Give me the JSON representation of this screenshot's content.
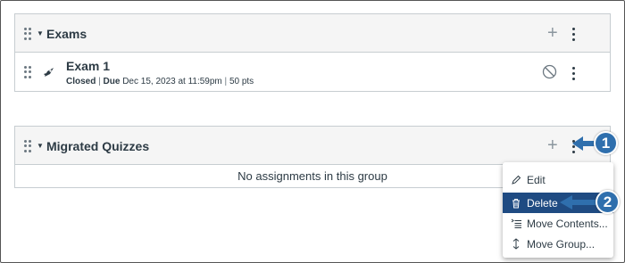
{
  "groups": [
    {
      "title": "Exams"
    },
    {
      "title": "Migrated Quizzes"
    }
  ],
  "assignment": {
    "title": "Exam 1",
    "status": "Closed",
    "due_label": "Due",
    "due_date": "Dec 15, 2023 at 11:59pm",
    "points": "50 pts",
    "separator": "|"
  },
  "empty_message": "No assignments in this group",
  "menu": {
    "items": [
      {
        "label": "Edit",
        "icon": "pencil-icon"
      },
      {
        "label": "Delete",
        "icon": "trash-icon"
      },
      {
        "label": "Move Contents...",
        "icon": "move-contents-icon"
      },
      {
        "label": "Move Group...",
        "icon": "move-updown-icon"
      }
    ]
  },
  "callouts": [
    "1",
    "2"
  ],
  "colors": {
    "callout": "#2f6fad",
    "menu_active": "#1f4b82",
    "header_bg": "#f5f5f5"
  }
}
